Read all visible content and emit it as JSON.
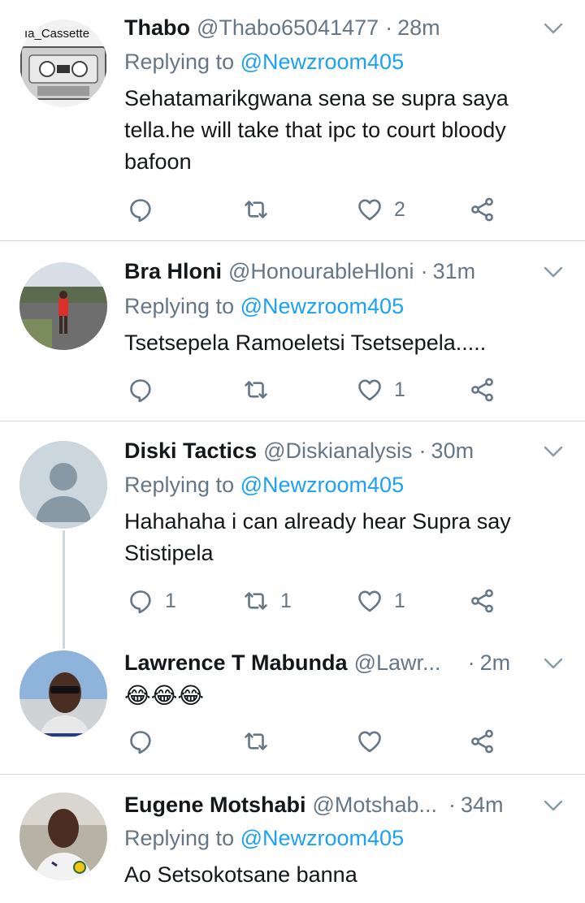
{
  "tweets": [
    {
      "name": "Thabo",
      "handle": "@Thabo65041477",
      "time": "28m",
      "replying_prefix": "Replying to",
      "replying_to": "@Newzroom405",
      "text": "Sehatamarikgwana sena se supra saya tella.he will take that ipc to court bloody bafoon",
      "avatar_label": "ıa_Cassette",
      "reply_count": "",
      "retweet_count": "",
      "like_count": "2"
    },
    {
      "name": "Bra Hloni",
      "handle": "@HonourableHloni",
      "time": "31m",
      "replying_prefix": "Replying to",
      "replying_to": "@Newzroom405",
      "text": "Tsetsepela Ramoeletsi Tsetsepela.....",
      "reply_count": "",
      "retweet_count": "",
      "like_count": "1"
    },
    {
      "name": "Diski Tactics",
      "handle": "@Diskianalysis",
      "time": "30m",
      "replying_prefix": "Replying to",
      "replying_to": "@Newzroom405",
      "text": "Hahahaha i can already hear Supra say Stistipela",
      "reply_count": "1",
      "retweet_count": "1",
      "like_count": "1"
    },
    {
      "name": "Lawrence T Mabunda",
      "handle": "@Lawr...",
      "time": "2m",
      "text": "😂😂😂",
      "reply_count": "",
      "retweet_count": "",
      "like_count": ""
    },
    {
      "name": "Eugene Motshabi",
      "handle": "@Motshab...",
      "time": "34m",
      "replying_prefix": "Replying to",
      "replying_to": "@Newzroom405",
      "text": "Ao Setsokotsane banna"
    }
  ],
  "time_separator": "·",
  "colors": {
    "accent": "#1da1f2",
    "secondary": "#657786",
    "divider": "#cfd6dc"
  }
}
